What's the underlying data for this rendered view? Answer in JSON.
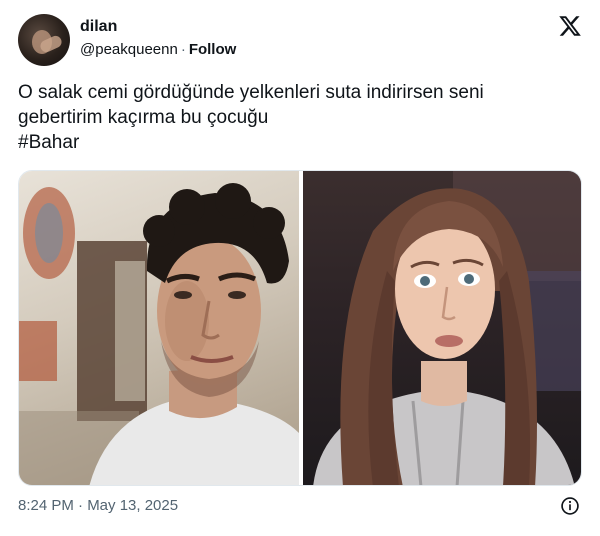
{
  "user": {
    "name": "dilan",
    "handle": "@peakqueenn",
    "separator": "·",
    "follow_label": "Follow"
  },
  "brand": {
    "logo_icon": "x-logo-icon",
    "color": "#0f1419"
  },
  "tweet": {
    "line1": "O salak cemi gördüğünde yelkenleri suta indirirsen seni",
    "line2": "gebertirim kaçırma bu çocuğu",
    "hashtag": "#Bahar"
  },
  "media": {
    "images": [
      {
        "name": "photo-left",
        "subject": "man-in-white-tshirt"
      },
      {
        "name": "photo-right",
        "subject": "girl-in-grey-hoodie"
      }
    ]
  },
  "footer": {
    "timestamp": "8:24 PM · May 13, 2025",
    "info_icon": "info-icon"
  },
  "colors": {
    "text": "#0f1419",
    "secondary": "#536471",
    "border": "#e1e8ed",
    "background": "#ffffff"
  }
}
